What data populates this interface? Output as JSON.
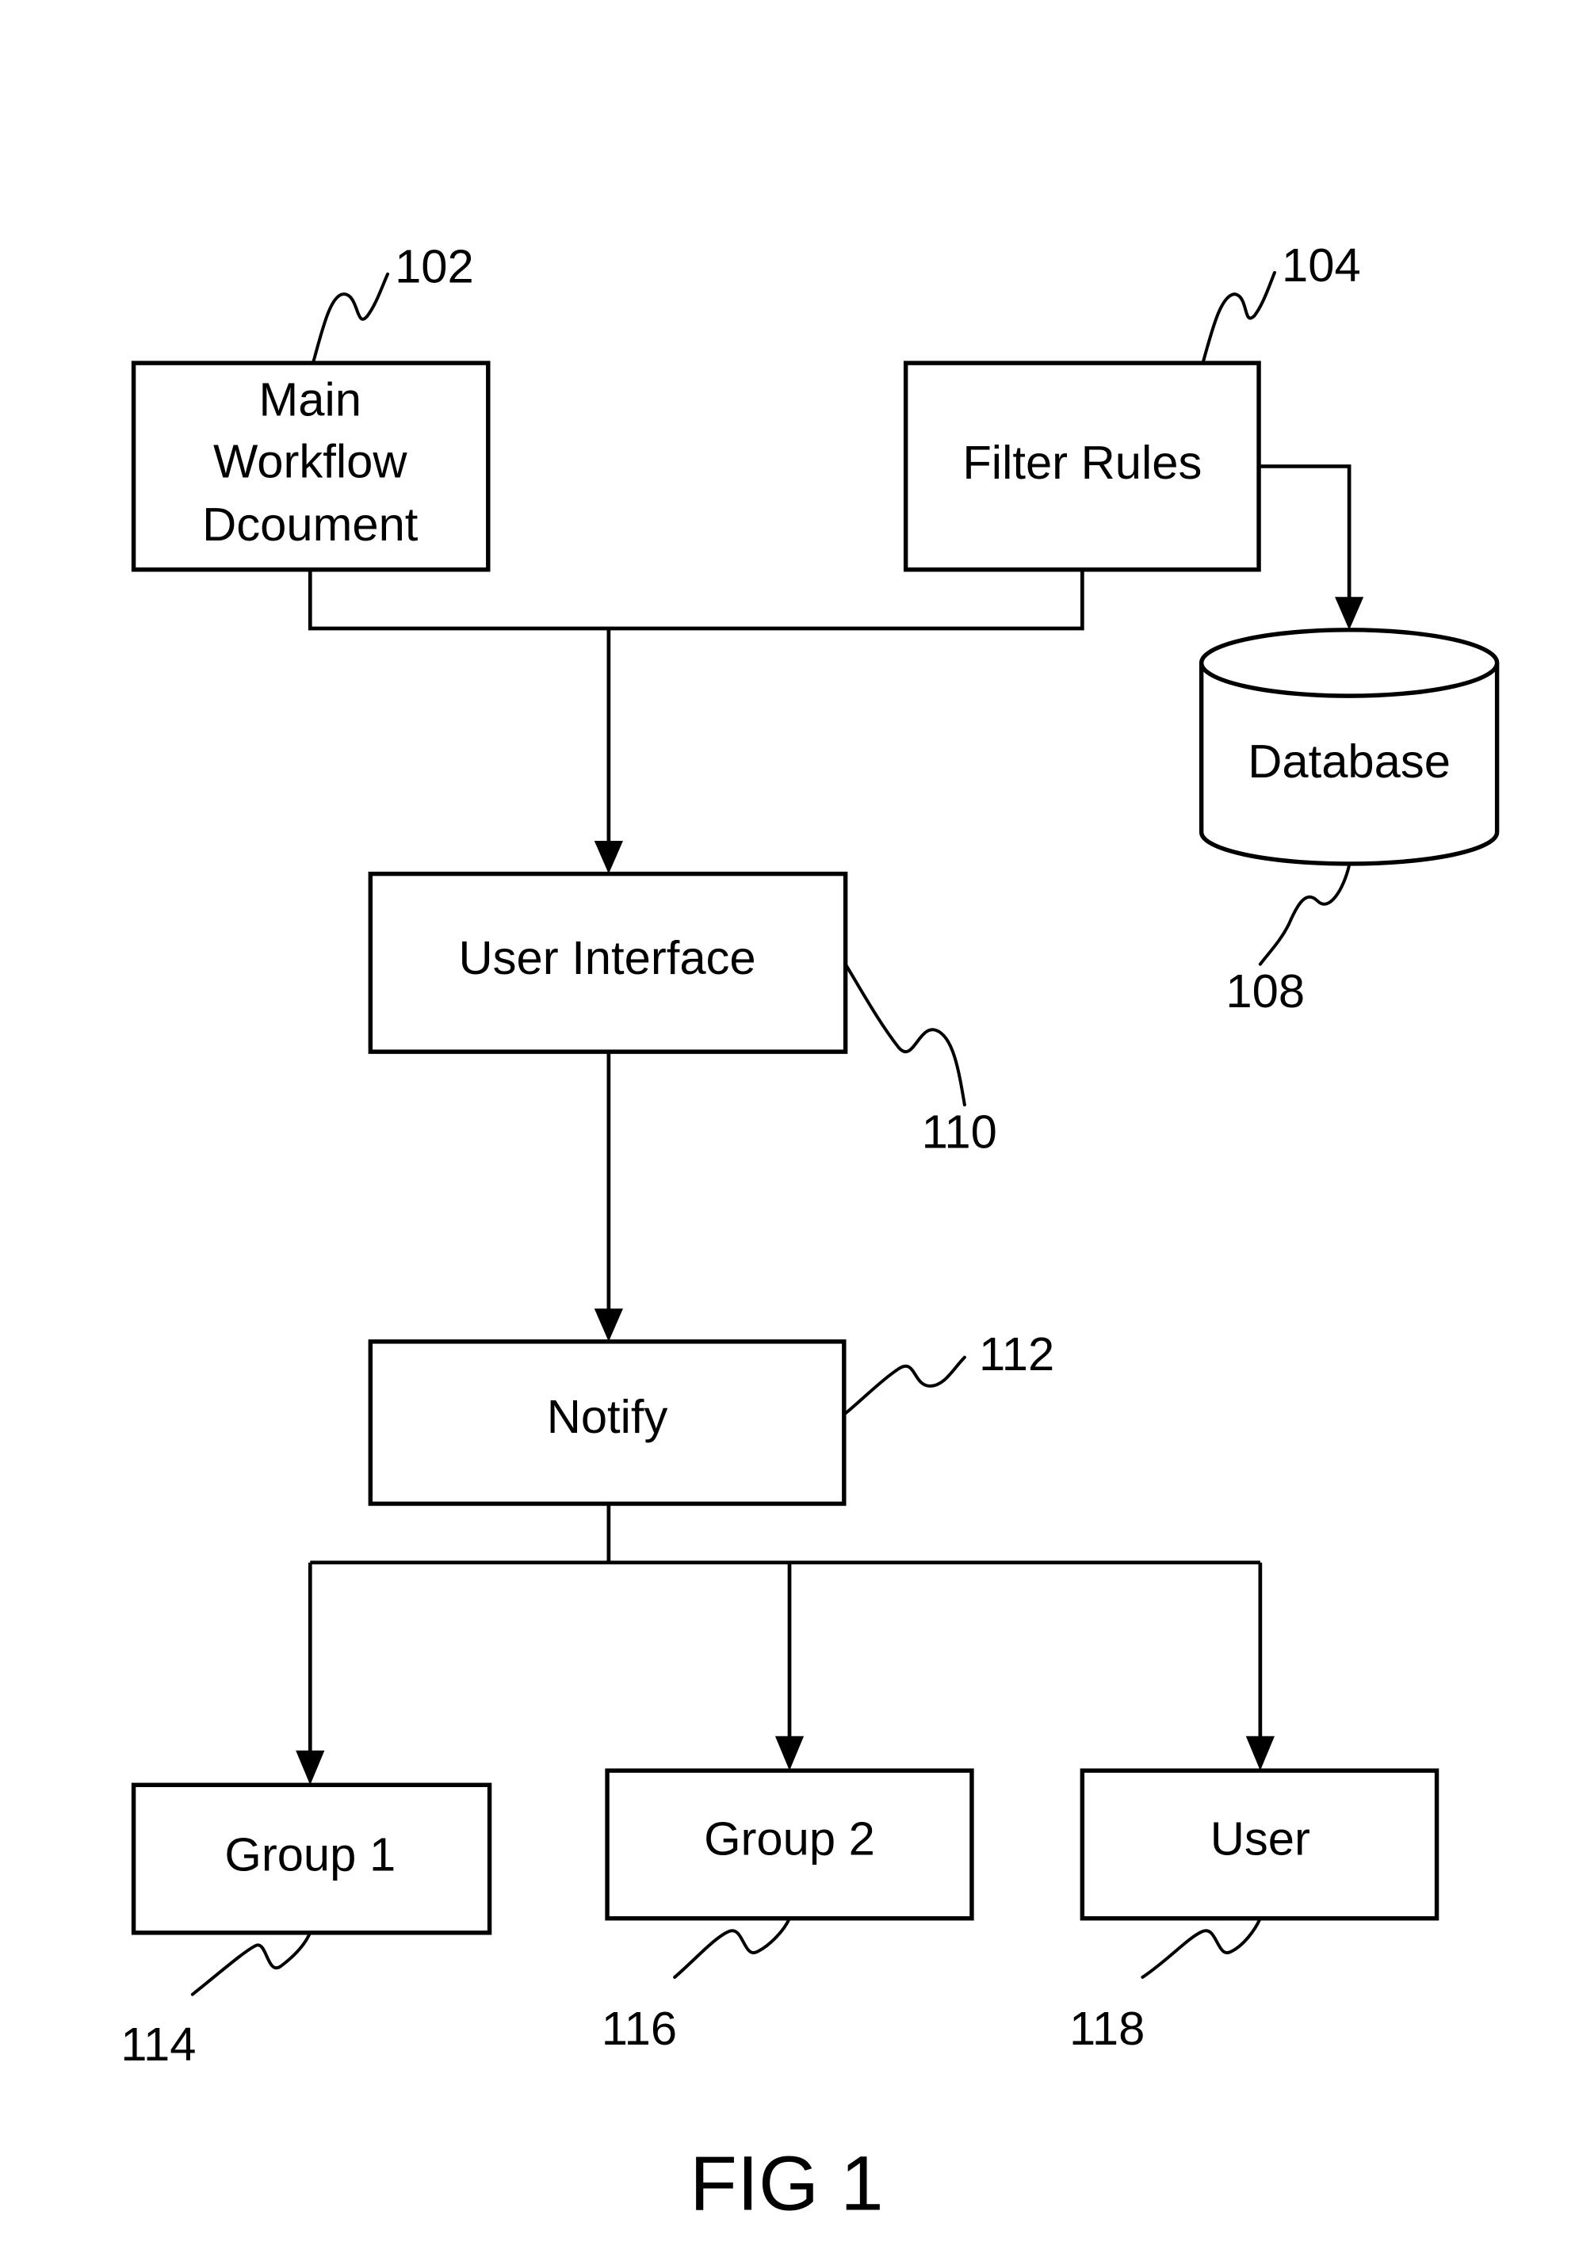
{
  "figure": {
    "caption": "FIG 1"
  },
  "nodes": {
    "main_workflow_document": {
      "lines": [
        "Main",
        "Workflow",
        "Dcoument"
      ],
      "ref": "102"
    },
    "filter_rules": {
      "label": "Filter Rules",
      "ref": "104"
    },
    "database": {
      "label": "Database",
      "ref": "108"
    },
    "user_interface": {
      "label": "User Interface",
      "ref": "110"
    },
    "notify": {
      "label": "Notify",
      "ref": "112"
    },
    "group_1": {
      "label": "Group 1",
      "ref": "114"
    },
    "group_2": {
      "label": "Group 2",
      "ref": "116"
    },
    "user": {
      "label": "User",
      "ref": "118"
    }
  },
  "edges": [
    {
      "from": "main_workflow_document",
      "to": "user_interface"
    },
    {
      "from": "filter_rules",
      "to": "user_interface"
    },
    {
      "from": "filter_rules",
      "to": "database"
    },
    {
      "from": "user_interface",
      "to": "notify"
    },
    {
      "from": "notify",
      "to": "group_1"
    },
    {
      "from": "notify",
      "to": "group_2"
    },
    {
      "from": "notify",
      "to": "user"
    }
  ],
  "colors": {
    "stroke": "#000000",
    "background": "#ffffff"
  }
}
